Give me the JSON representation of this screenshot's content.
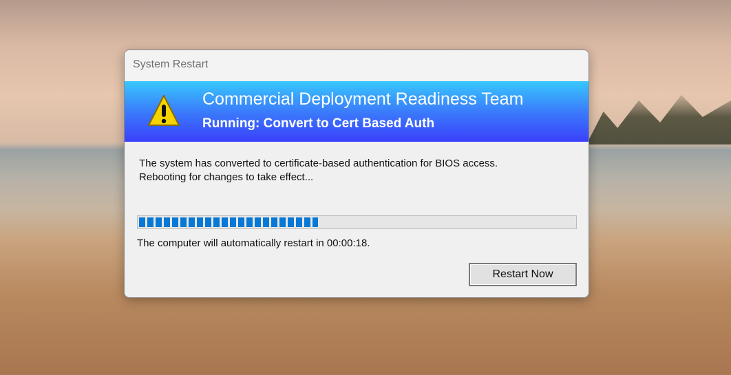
{
  "window": {
    "title": "System Restart"
  },
  "banner": {
    "icon": "warning-icon",
    "heading": "Commercial Deployment Readiness Team",
    "subheading": "Running: Convert to Cert Based Auth",
    "colors": {
      "top": "#38c8fe",
      "bottom": "#3a40fb"
    }
  },
  "message": {
    "line1": "The system has converted to certificate-based authentication for BIOS access.",
    "line2": "Rebooting for changes to take effect..."
  },
  "progress": {
    "percent": 41,
    "color": "#0678d7"
  },
  "countdown": "The computer will automatically restart in 00:00:18.",
  "buttons": {
    "restart_now": "Restart Now"
  }
}
